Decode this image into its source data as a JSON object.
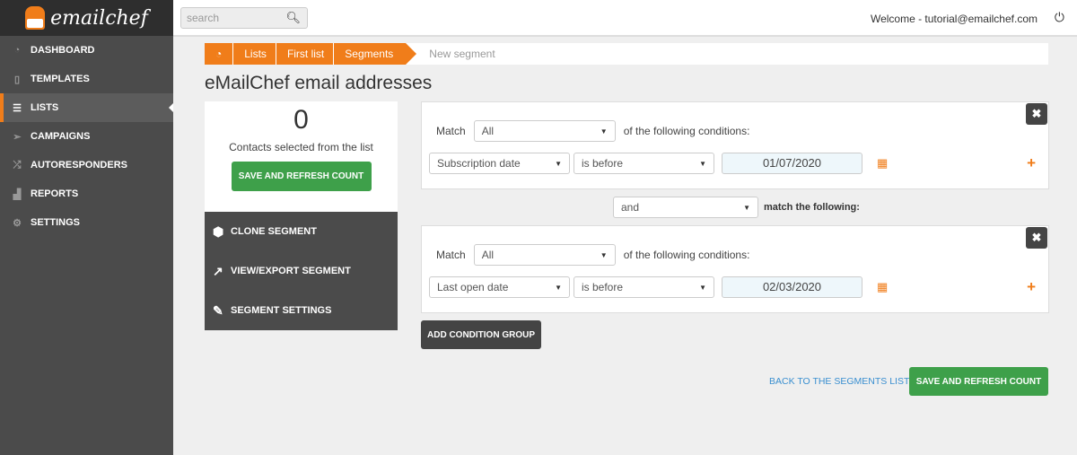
{
  "app": {
    "logo_text": "emailchef"
  },
  "sidebar": {
    "items": [
      {
        "label": "DASHBOARD",
        "icon": "dashboard-icon",
        "glyph": "◔"
      },
      {
        "label": "TEMPLATES",
        "icon": "file-icon",
        "glyph": "▯"
      },
      {
        "label": "LISTS",
        "icon": "list-icon",
        "glyph": "☰"
      },
      {
        "label": "CAMPAIGNS",
        "icon": "paper-plane-icon",
        "glyph": "➢"
      },
      {
        "label": "AUTORESPONDERS",
        "icon": "shuffle-icon",
        "glyph": "⤮"
      },
      {
        "label": "REPORTS",
        "icon": "chart-icon",
        "glyph": "▟"
      },
      {
        "label": "SETTINGS",
        "icon": "gears-icon",
        "glyph": "⚙"
      }
    ]
  },
  "topbar": {
    "search_placeholder": "search",
    "welcome": "Welcome - tutorial@emailchef.com"
  },
  "breadcrumb": {
    "items": [
      "Lists",
      "First list",
      "Segments"
    ],
    "current": "New segment"
  },
  "page": {
    "title": "eMailChef email addresses"
  },
  "count_panel": {
    "count": "0",
    "label": "Contacts selected from the list",
    "button": "SAVE AND REFRESH COUNT"
  },
  "actions": [
    "CLONE SEGMENT",
    "VIEW/EXPORT SEGMENT",
    "SEGMENT SETTINGS"
  ],
  "groups": [
    {
      "match_label": "Match",
      "match_value": "All",
      "suffix": "of the following conditions:",
      "field": "Subscription date",
      "operator": "is before",
      "date": "01/07/2020"
    },
    {
      "match_label": "Match",
      "match_value": "All",
      "suffix": "of the following conditions:",
      "field": "Last open date",
      "operator": "is before",
      "date": "02/03/2020"
    }
  ],
  "connector": {
    "value": "and",
    "label": "match the following:"
  },
  "buttons": {
    "add_group": "ADD CONDITION GROUP",
    "back": "BACK TO THE SEGMENTS LIST",
    "save": "SAVE AND REFRESH COUNT"
  },
  "colors": {
    "accent": "#f07d1a",
    "green": "#3ea04a",
    "dark": "#4b4b4b"
  }
}
